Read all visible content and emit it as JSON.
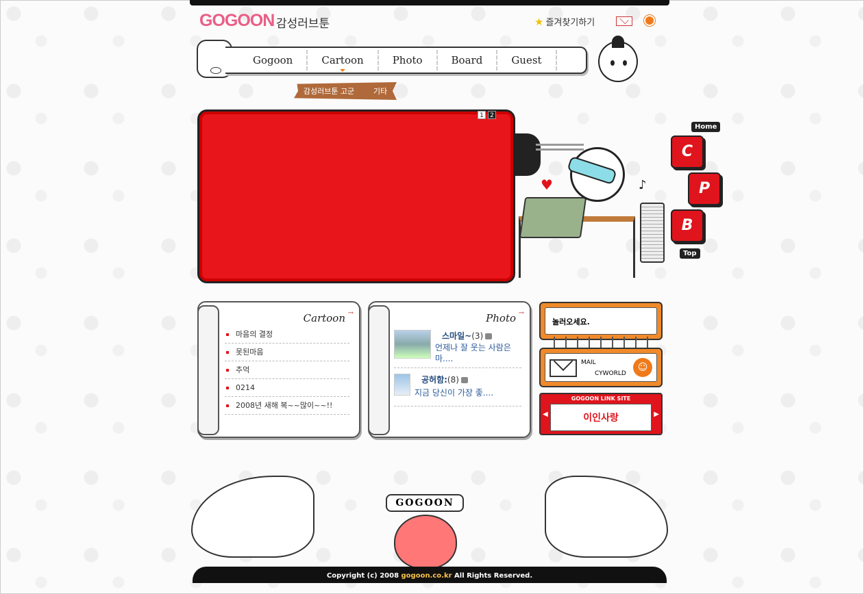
{
  "header": {
    "logo": "GOGOON",
    "logo_sub": "감성러브툰",
    "favorite": "즐겨찾기하기"
  },
  "nav": {
    "items": [
      "Gogoon",
      "Cartoon",
      "Photo",
      "Board",
      "Guest"
    ],
    "active": "Cartoon"
  },
  "subnav": [
    "감성러브툰 고군",
    "기타"
  ],
  "banner": {
    "pages": [
      "1",
      "2"
    ],
    "fill": "#e8151b"
  },
  "side": {
    "home": "Home",
    "buttons": [
      "C",
      "P",
      "B"
    ],
    "top": "Top"
  },
  "cartoon_box": {
    "title": "Cartoon",
    "items": [
      "마음의 결정",
      "못된마음",
      "추억",
      "0214",
      "2008년 새해 복~~많이~~!!"
    ]
  },
  "photo_box": {
    "title": "Photo",
    "items": [
      {
        "title": "스마일~",
        "count": "(3)",
        "desc": "언제나 잘 웃는 사람은 마...."
      },
      {
        "title": "공허함:",
        "count": "(8)",
        "desc": "지금 당신이 가장 좋...."
      }
    ]
  },
  "right": {
    "hello": "놀러오세요.",
    "mail": "MAIL",
    "cyworld": "CYWORLD",
    "link_title": "GOGOON LINK SITE",
    "link_text": "이인사랑"
  },
  "footer": {
    "ribbon": "GOGOON",
    "copy_prefix": "Copyright (c) 2008",
    "domain": "gogoon.co.kr",
    "copy_suffix": "All Rights Reserved."
  },
  "colors": {
    "accent": "#e8151b",
    "orange": "#f08a2a",
    "pink": "#ea5e86"
  }
}
